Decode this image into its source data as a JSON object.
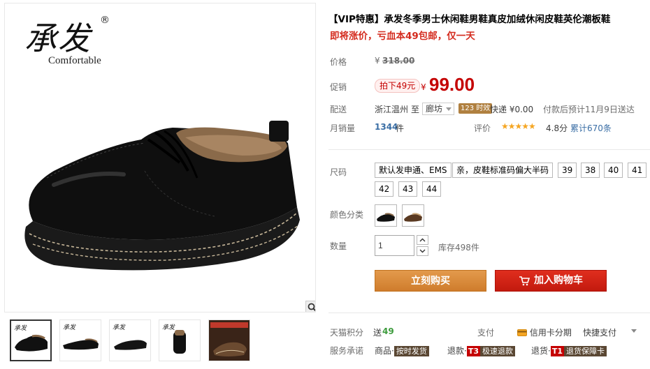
{
  "brand": {
    "cn": "承发",
    "reg": "®",
    "en": "Comfortable"
  },
  "product": {
    "title": "【VIP特惠】承发冬季男士休闲鞋男鞋真皮加绒休闲皮鞋英伦潮板鞋",
    "subtitle": "即将涨价，亏血本49包邮，仅一天"
  },
  "price": {
    "label": "价格",
    "yen": "¥",
    "original": "318.00",
    "promo_label": "促销",
    "promo_tag": "拍下49元",
    "promo_yen": "¥",
    "promo_price": "99.00"
  },
  "shipping": {
    "label": "配送",
    "origin": "浙江温州",
    "to": "至",
    "dest": "廊坊",
    "badge": "123 时效",
    "courier": "快递 ¥0.00",
    "eta": "付款后预计11月9日送达"
  },
  "sales": {
    "label": "月销量",
    "count": "1344",
    "unit": "件",
    "rating_label": "评价",
    "stars": "★★★★★",
    "score": "4.8分",
    "review_count": "累计670条"
  },
  "size": {
    "label": "尺码",
    "options": [
      "默认发申通、EMS",
      "亲，皮鞋标准码偏大半码",
      "39",
      "38",
      "40",
      "41",
      "42",
      "43",
      "44"
    ]
  },
  "color": {
    "label": "颜色分类"
  },
  "quantity": {
    "label": "数量",
    "value": "1",
    "stock": "库存498件"
  },
  "buttons": {
    "buy": "立刻购买",
    "cart": "加入购物车"
  },
  "footer": {
    "points_label": "天猫积分",
    "points_prefix": "送",
    "points_value": "49",
    "pay_label": "支付",
    "credit": "信用卡分期",
    "quick_pay": "快捷支付",
    "service_label": "服务承诺",
    "svc1_prefix": "商品·",
    "svc1_tag": "按时发货",
    "svc2_prefix": "退款·",
    "svc2_t": "T3",
    "svc2_tag": "极速退款",
    "svc3_prefix": "退货·",
    "svc3_t": "T1",
    "svc3_tag": "退货保障卡"
  },
  "colors": {
    "accent_red": "#c40000",
    "buy_orange": "#d98b3a",
    "cart_red": "#d0251a"
  }
}
